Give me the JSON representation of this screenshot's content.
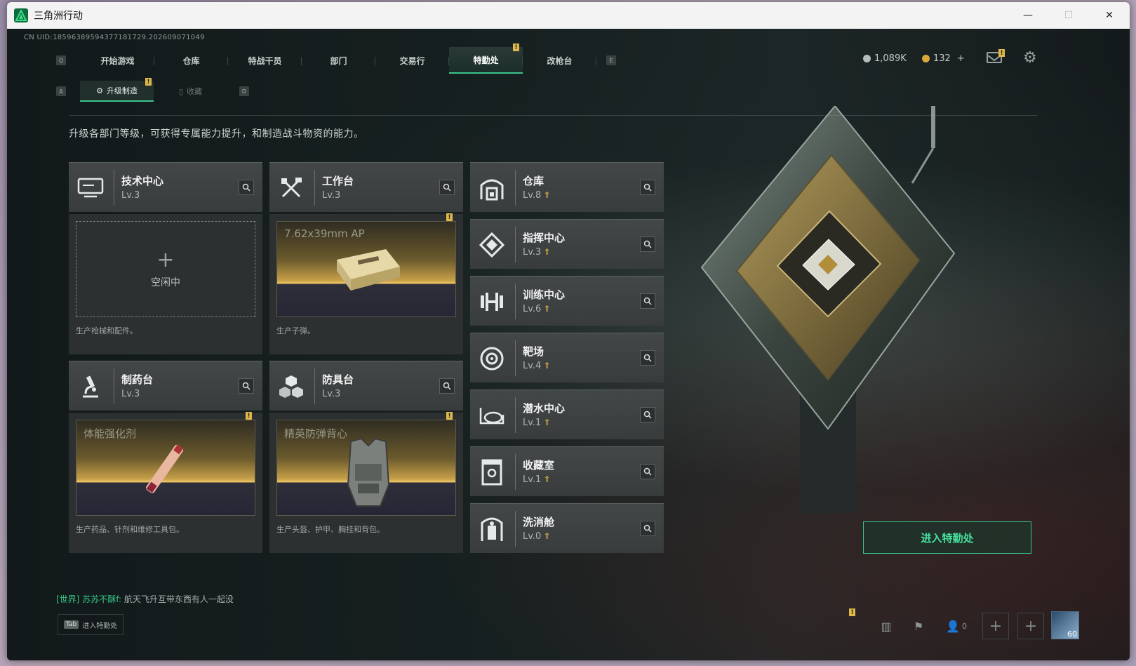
{
  "window": {
    "title": "三角洲行动",
    "minimize": "—",
    "maximize": "☐",
    "close": "✕"
  },
  "uid": "CN UID:185963895943771817​29.202609071049",
  "nav": {
    "key_left": "Q",
    "key_right": "E",
    "tabs": [
      {
        "label": "开始游戏",
        "active": false
      },
      {
        "label": "仓库",
        "active": false
      },
      {
        "label": "特战干员",
        "active": false
      },
      {
        "label": "部门",
        "active": false
      },
      {
        "label": "交易行",
        "active": false
      },
      {
        "label": "特勤处",
        "active": true
      },
      {
        "label": "改枪台",
        "active": false
      }
    ],
    "badge": "!"
  },
  "currency": {
    "silver": "1,089K",
    "gold": "132",
    "add": "+"
  },
  "subnav": {
    "key_left": "A",
    "key_right": "D",
    "tabs": [
      {
        "label": "升级制造",
        "active": true
      },
      {
        "label": "收藏",
        "active": false
      }
    ]
  },
  "description": "升级各部门等级，可获得专属能力提升，和制造战斗物资的能力。",
  "production_depts": [
    {
      "name": "技术中心",
      "level": "Lv.3",
      "icon": "monitor-icon",
      "state": "idle",
      "idle_text": "空闲中",
      "caption": "生产枪械和配件。"
    },
    {
      "name": "工作台",
      "level": "Lv.3",
      "icon": "tools-icon",
      "state": "busy",
      "item": "7.62x39mm AP",
      "caption": "生产子弹。"
    },
    {
      "name": "制药台",
      "level": "Lv.3",
      "icon": "microscope-icon",
      "state": "busy",
      "item": "体能强化剂",
      "caption": "生产药品、针剂和维修工具包。"
    },
    {
      "name": "防具台",
      "level": "Lv.3",
      "icon": "cubes-icon",
      "state": "busy",
      "item": "精英防弹背心",
      "caption": "生产头盔、护甲、胸挂和背包。"
    }
  ],
  "other_depts": [
    {
      "name": "仓库",
      "level": "Lv.8",
      "icon": "warehouse-icon"
    },
    {
      "name": "指挥中心",
      "level": "Lv.3",
      "icon": "command-icon"
    },
    {
      "name": "训练中心",
      "level": "Lv.6",
      "icon": "dumbbell-icon"
    },
    {
      "name": "靶场",
      "level": "Lv.4",
      "icon": "target-icon"
    },
    {
      "name": "潜水中心",
      "level": "Lv.1",
      "icon": "diving-mask-icon"
    },
    {
      "name": "收藏室",
      "level": "Lv.1",
      "icon": "collection-icon"
    },
    {
      "name": "洗消舱",
      "level": "Lv.0",
      "icon": "decon-icon"
    }
  ],
  "enter_button": "进入特勤处",
  "chat": {
    "channel": "[世界]",
    "name": "苏苏不酥f:",
    "message": "航天飞升互带东西有人一起没"
  },
  "tab_hint": {
    "key": "Tab",
    "label": "进入特勤处"
  },
  "friends_count": "0",
  "player_level": "60",
  "colors": {
    "accent": "#39c48a",
    "gold": "#e0b84a"
  }
}
